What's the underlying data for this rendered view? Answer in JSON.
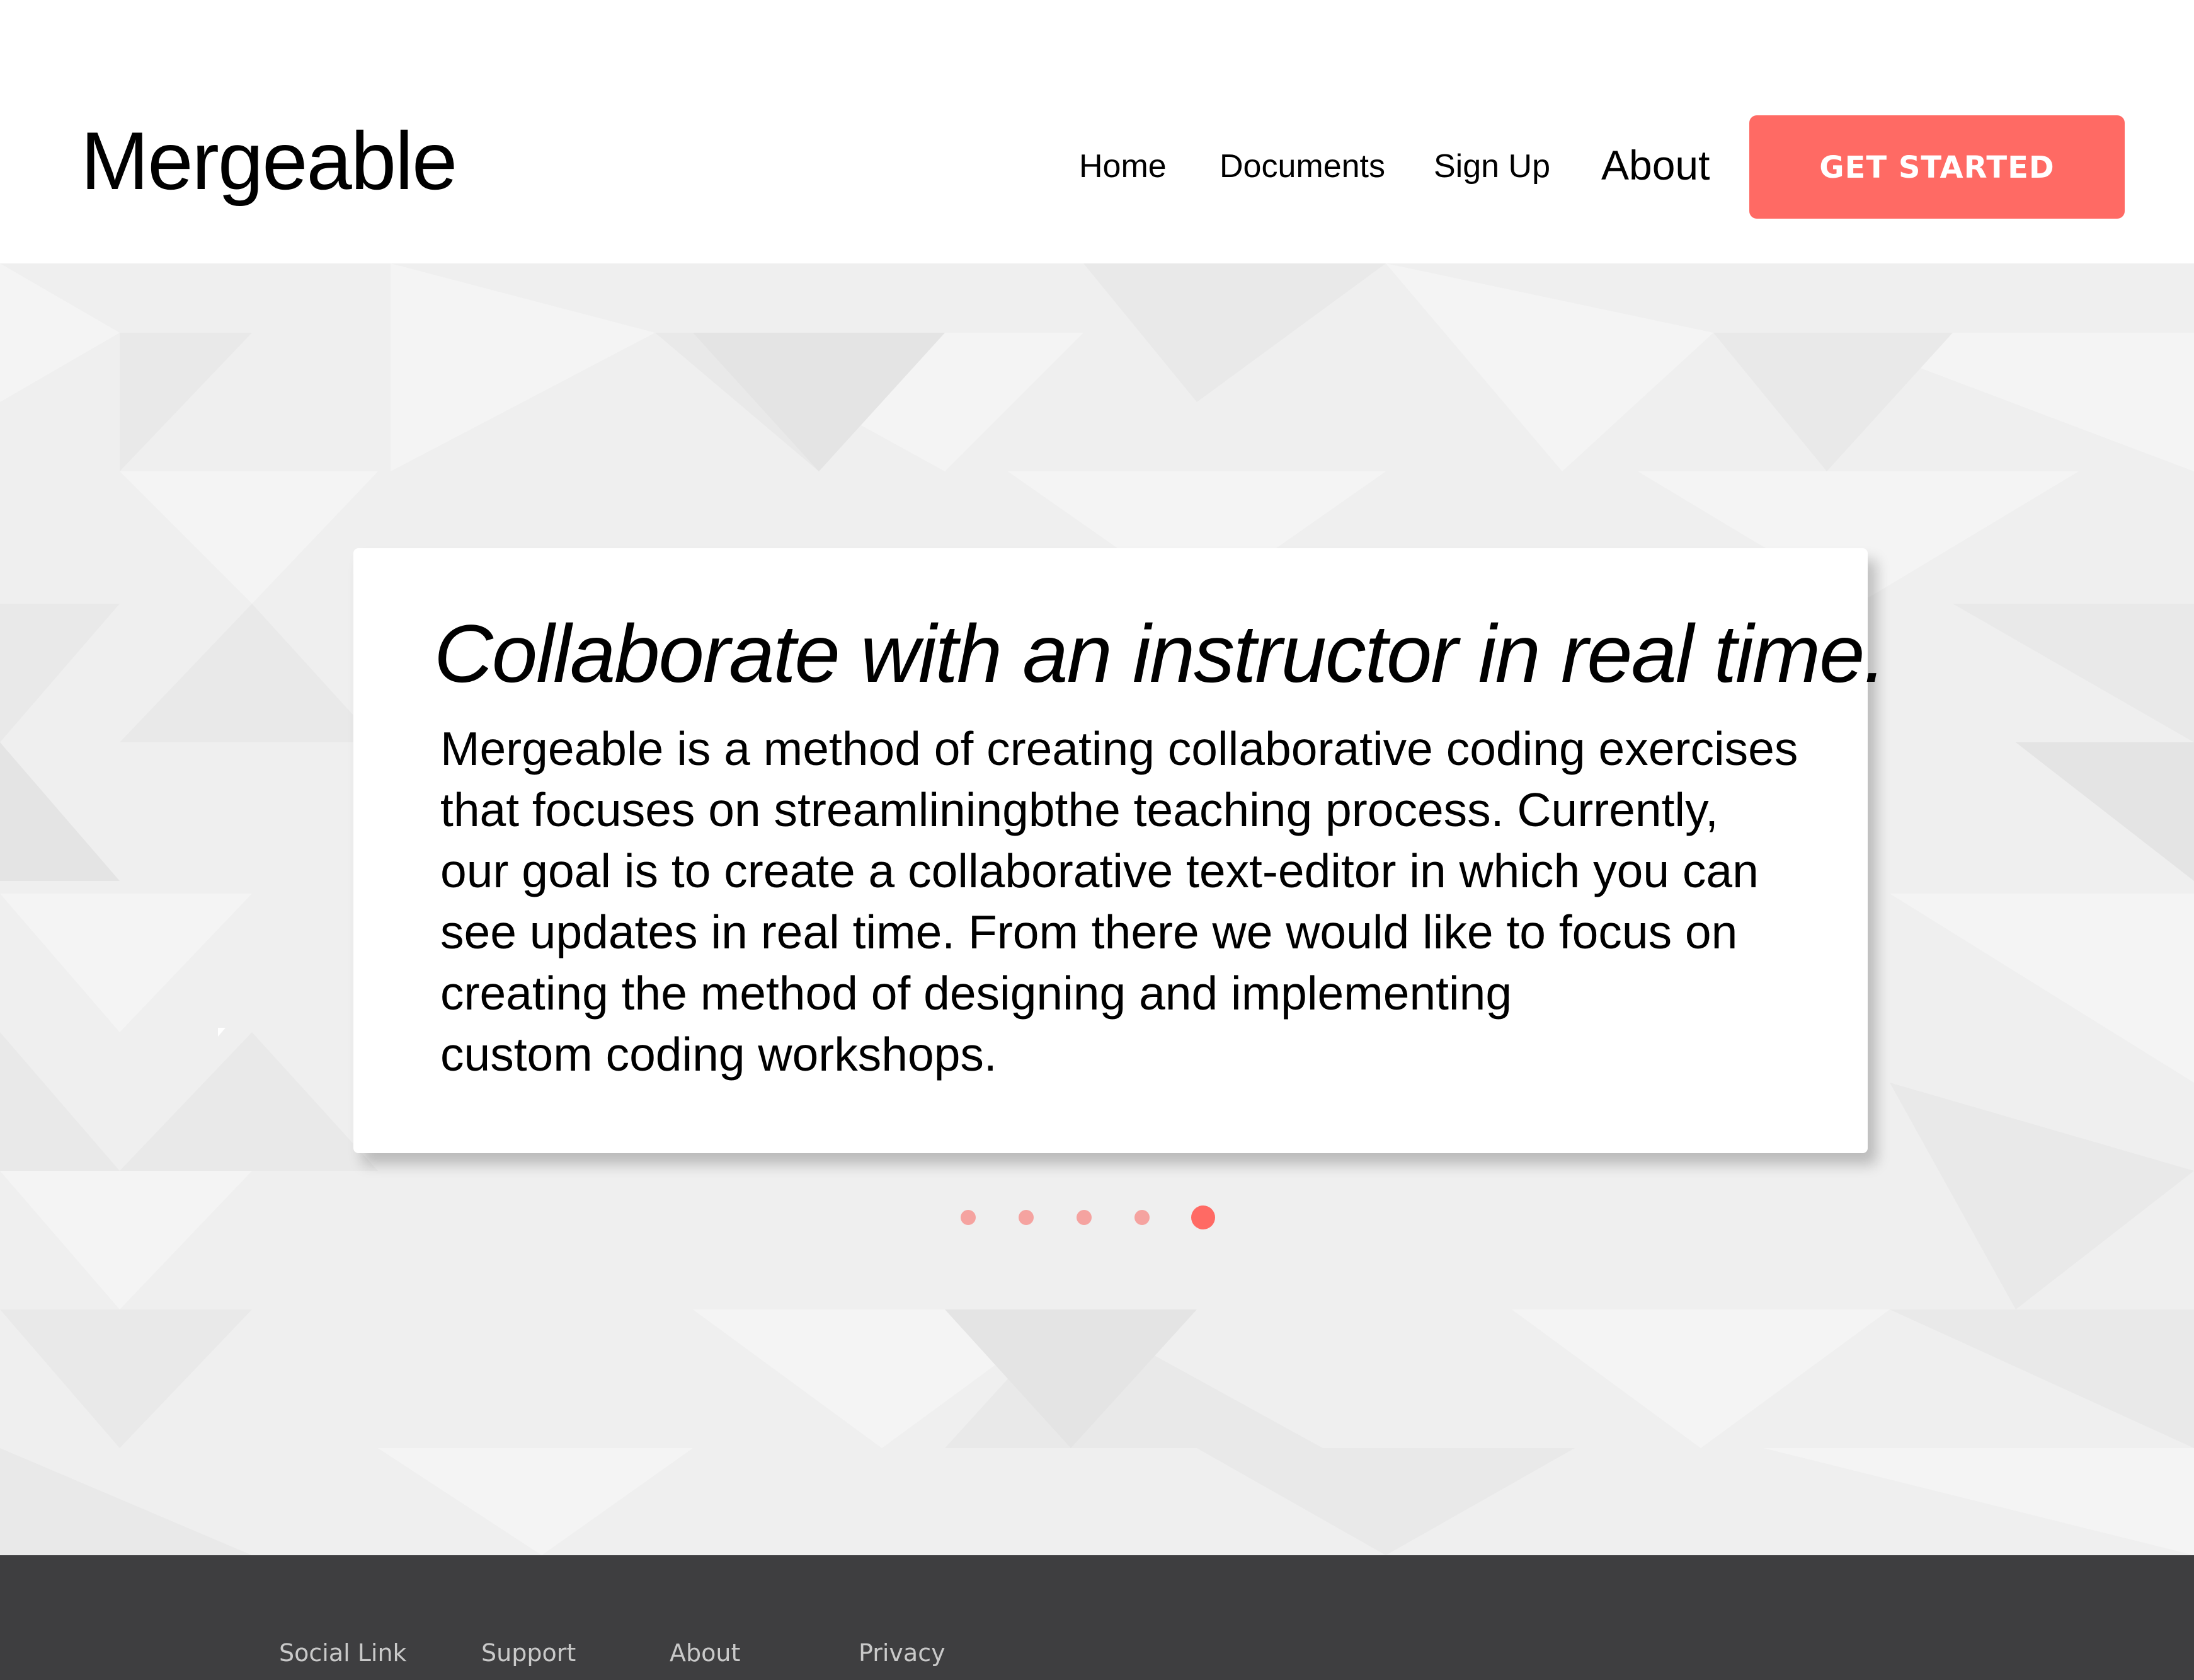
{
  "brand": {
    "name": "Mergeable"
  },
  "nav": {
    "items": [
      {
        "label": "Home"
      },
      {
        "label": "Documents"
      },
      {
        "label": "Sign Up"
      },
      {
        "label": "About"
      }
    ],
    "cta_label": "GET STARTED"
  },
  "hero": {
    "title": "Collaborate with an instructor in real time.",
    "body_lines": [
      "Mergeable is a method of creating collaborative coding exercises",
      "that focuses on streamliningbthe teaching process. Currently,",
      "our goal is to create a collaborative text-editor in which you can",
      "see updates in real time. From there we would like to focus on",
      "creating the method of designing and implementing",
      "custom coding workshops."
    ],
    "carousel": {
      "slide_count": 5,
      "active_index": 4
    }
  },
  "footer": {
    "links": [
      {
        "label": "Social Link"
      },
      {
        "label": "Support"
      },
      {
        "label": "About"
      },
      {
        "label": "Privacy"
      }
    ]
  },
  "colors": {
    "accent": "#ff6a64",
    "accent_light": "#f5a3a0",
    "hero_bg": "#efefef",
    "footer_bg": "#3e3e40",
    "footer_text": "#c9c9c9"
  },
  "icons": {
    "pointer": "cursor-pointer-icon"
  }
}
